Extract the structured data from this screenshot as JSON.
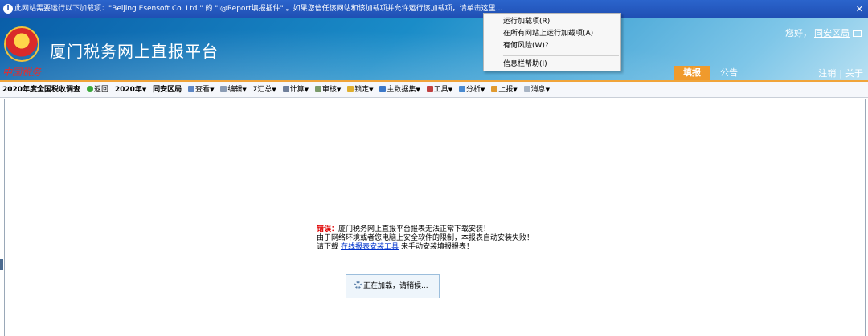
{
  "infobar": {
    "message": "此网站需要运行以下加载项：\"Beijing Esensoft Co. Ltd.\" 的 \"i@Report填报插件\" 。如果您信任该网站和该加载项并允许运行该加载项，请单击这里...",
    "close": "✕"
  },
  "context_menu": {
    "items": [
      "运行加载项(R)",
      "在所有网站上运行加载项(A)",
      "有何风险(W)?",
      "信息栏帮助(I)"
    ]
  },
  "header": {
    "emblem_caption": "中国税务",
    "title": "厦门税务网上直报平台",
    "greeting": "您好，",
    "user": "同安区局",
    "tabs": [
      "填报",
      "公告"
    ],
    "logout": "注销",
    "separator": "|",
    "about": "关于"
  },
  "toolbar": {
    "survey": "2020年度全国税收调查",
    "back": "返回",
    "year": "2020年",
    "region": "同安区局",
    "items": [
      "查看",
      "编辑",
      "汇总",
      "计算",
      "审核",
      "锁定",
      "主数据集",
      "工具",
      "分析",
      "上报",
      "消息"
    ],
    "caret": "▼",
    "sigma": "Σ"
  },
  "content": {
    "error_label": "错误：",
    "error_line1": "厦门税务网上直报平台报表无法正常下载安装！",
    "error_line2": "由于网络环境或者您电脑上安全软件的限制，本报表自动安装失败！",
    "error_line3_prefix": "请下载",
    "download_link": "在线报表安装工具",
    "error_line3_suffix": "来手动安装填报报表！",
    "loading": "正在加载，请稍候..."
  },
  "colors": {
    "infobar": "#1f4fb3",
    "accent_orange": "#f09a2c",
    "error_red": "#e00000",
    "link_blue": "#0033cc"
  }
}
